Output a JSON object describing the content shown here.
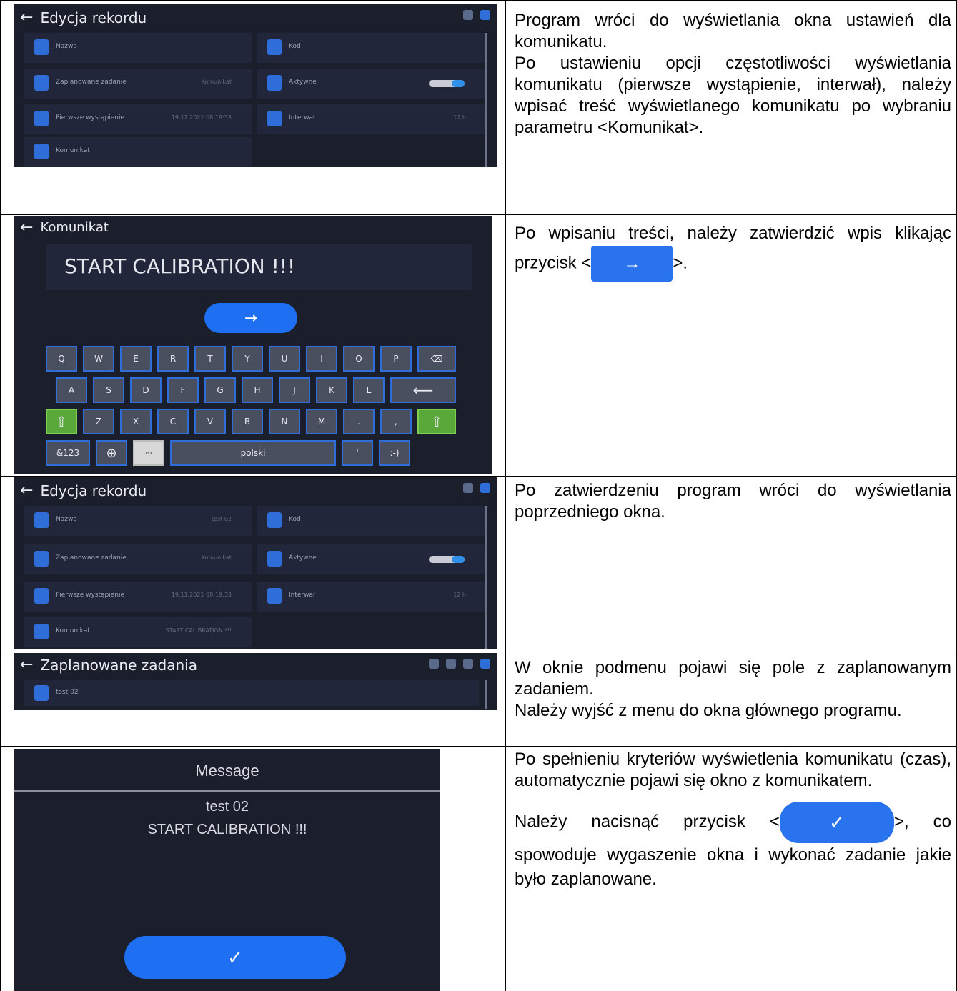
{
  "rows": [
    {
      "text": [
        "Program wróci do wyświetlania okna ustawień dla komunikatu.",
        "Po ustawieniu opcji częstotliwości wyświetlania komunikatu (pierwsze wystąpienie, interwał), należy wpisać treść wyświetlanego komunikatu po wybraniu parametru <Komunikat>."
      ],
      "screen": {
        "title": "Edycja rekordu",
        "tiles": [
          {
            "label": "Nazwa",
            "value": ""
          },
          {
            "label": "Kod",
            "value": ""
          },
          {
            "label": "Zaplanowane zadanie",
            "value": "Komunikat"
          },
          {
            "label": "Aktywne",
            "value": ""
          },
          {
            "label": "Pierwsze wystąpienie",
            "value": "19.11.2021 08:19:33"
          },
          {
            "label": "Interwał",
            "value": "12 h"
          },
          {
            "label": "Komunikat",
            "value": ""
          }
        ]
      }
    },
    {
      "text_before": "Po wpisaniu treści, należy zatwierdzić wpis klikając przycisk <",
      "text_after": ">.",
      "screen": {
        "title": "Komunikat",
        "input_value": "START CALIBRATION !!!",
        "confirm_icon": "→",
        "keys_row1": [
          "Q",
          "W",
          "E",
          "R",
          "T",
          "Y",
          "U",
          "I",
          "O",
          "P"
        ],
        "keys_row2": [
          "A",
          "S",
          "D",
          "F",
          "G",
          "H",
          "J",
          "K",
          "L"
        ],
        "keys_row3": [
          "Z",
          "X",
          "C",
          "V",
          "B",
          "N",
          "M",
          ".",
          ","
        ],
        "sym_key": "&123",
        "space_label": "polski",
        "apostrophe": "'",
        "smiley": ":-)"
      }
    },
    {
      "text": [
        "Po zatwierdzeniu program wróci do wyświetlania poprzedniego okna."
      ],
      "screen": {
        "title": "Edycja rekordu",
        "tiles": [
          {
            "label": "Nazwa",
            "value": "test 02"
          },
          {
            "label": "Kod",
            "value": ""
          },
          {
            "label": "Zaplanowane zadanie",
            "value": "Komunikat"
          },
          {
            "label": "Aktywne",
            "value": ""
          },
          {
            "label": "Pierwsze wystąpienie",
            "value": "19.11.2021 08:19:33"
          },
          {
            "label": "Interwał",
            "value": "12 h"
          },
          {
            "label": "Komunikat",
            "value": "START CALIBRATION !!!"
          }
        ]
      }
    },
    {
      "text": [
        "W oknie podmenu pojawi się pole z zaplanowanym zadaniem.",
        "Należy wyjść z menu do okna głównego programu."
      ],
      "screen": {
        "title": "Zaplanowane zadania",
        "item": "test 02"
      }
    },
    {
      "text1": "Po spełnieniu kryteriów wyświetlenia komunikatu (czas), automatycznie pojawi się okno z komunikatem.",
      "text2_before": "Należy nacisnąć przycisk <",
      "text2_after": ">, co spowoduje wygaszenie okna i wykonać zadanie jakie było zaplanowane.",
      "screen": {
        "title": "Message",
        "line1": "test 02",
        "line2": "START CALIBRATION !!!",
        "confirm_icon": "✓"
      }
    }
  ]
}
